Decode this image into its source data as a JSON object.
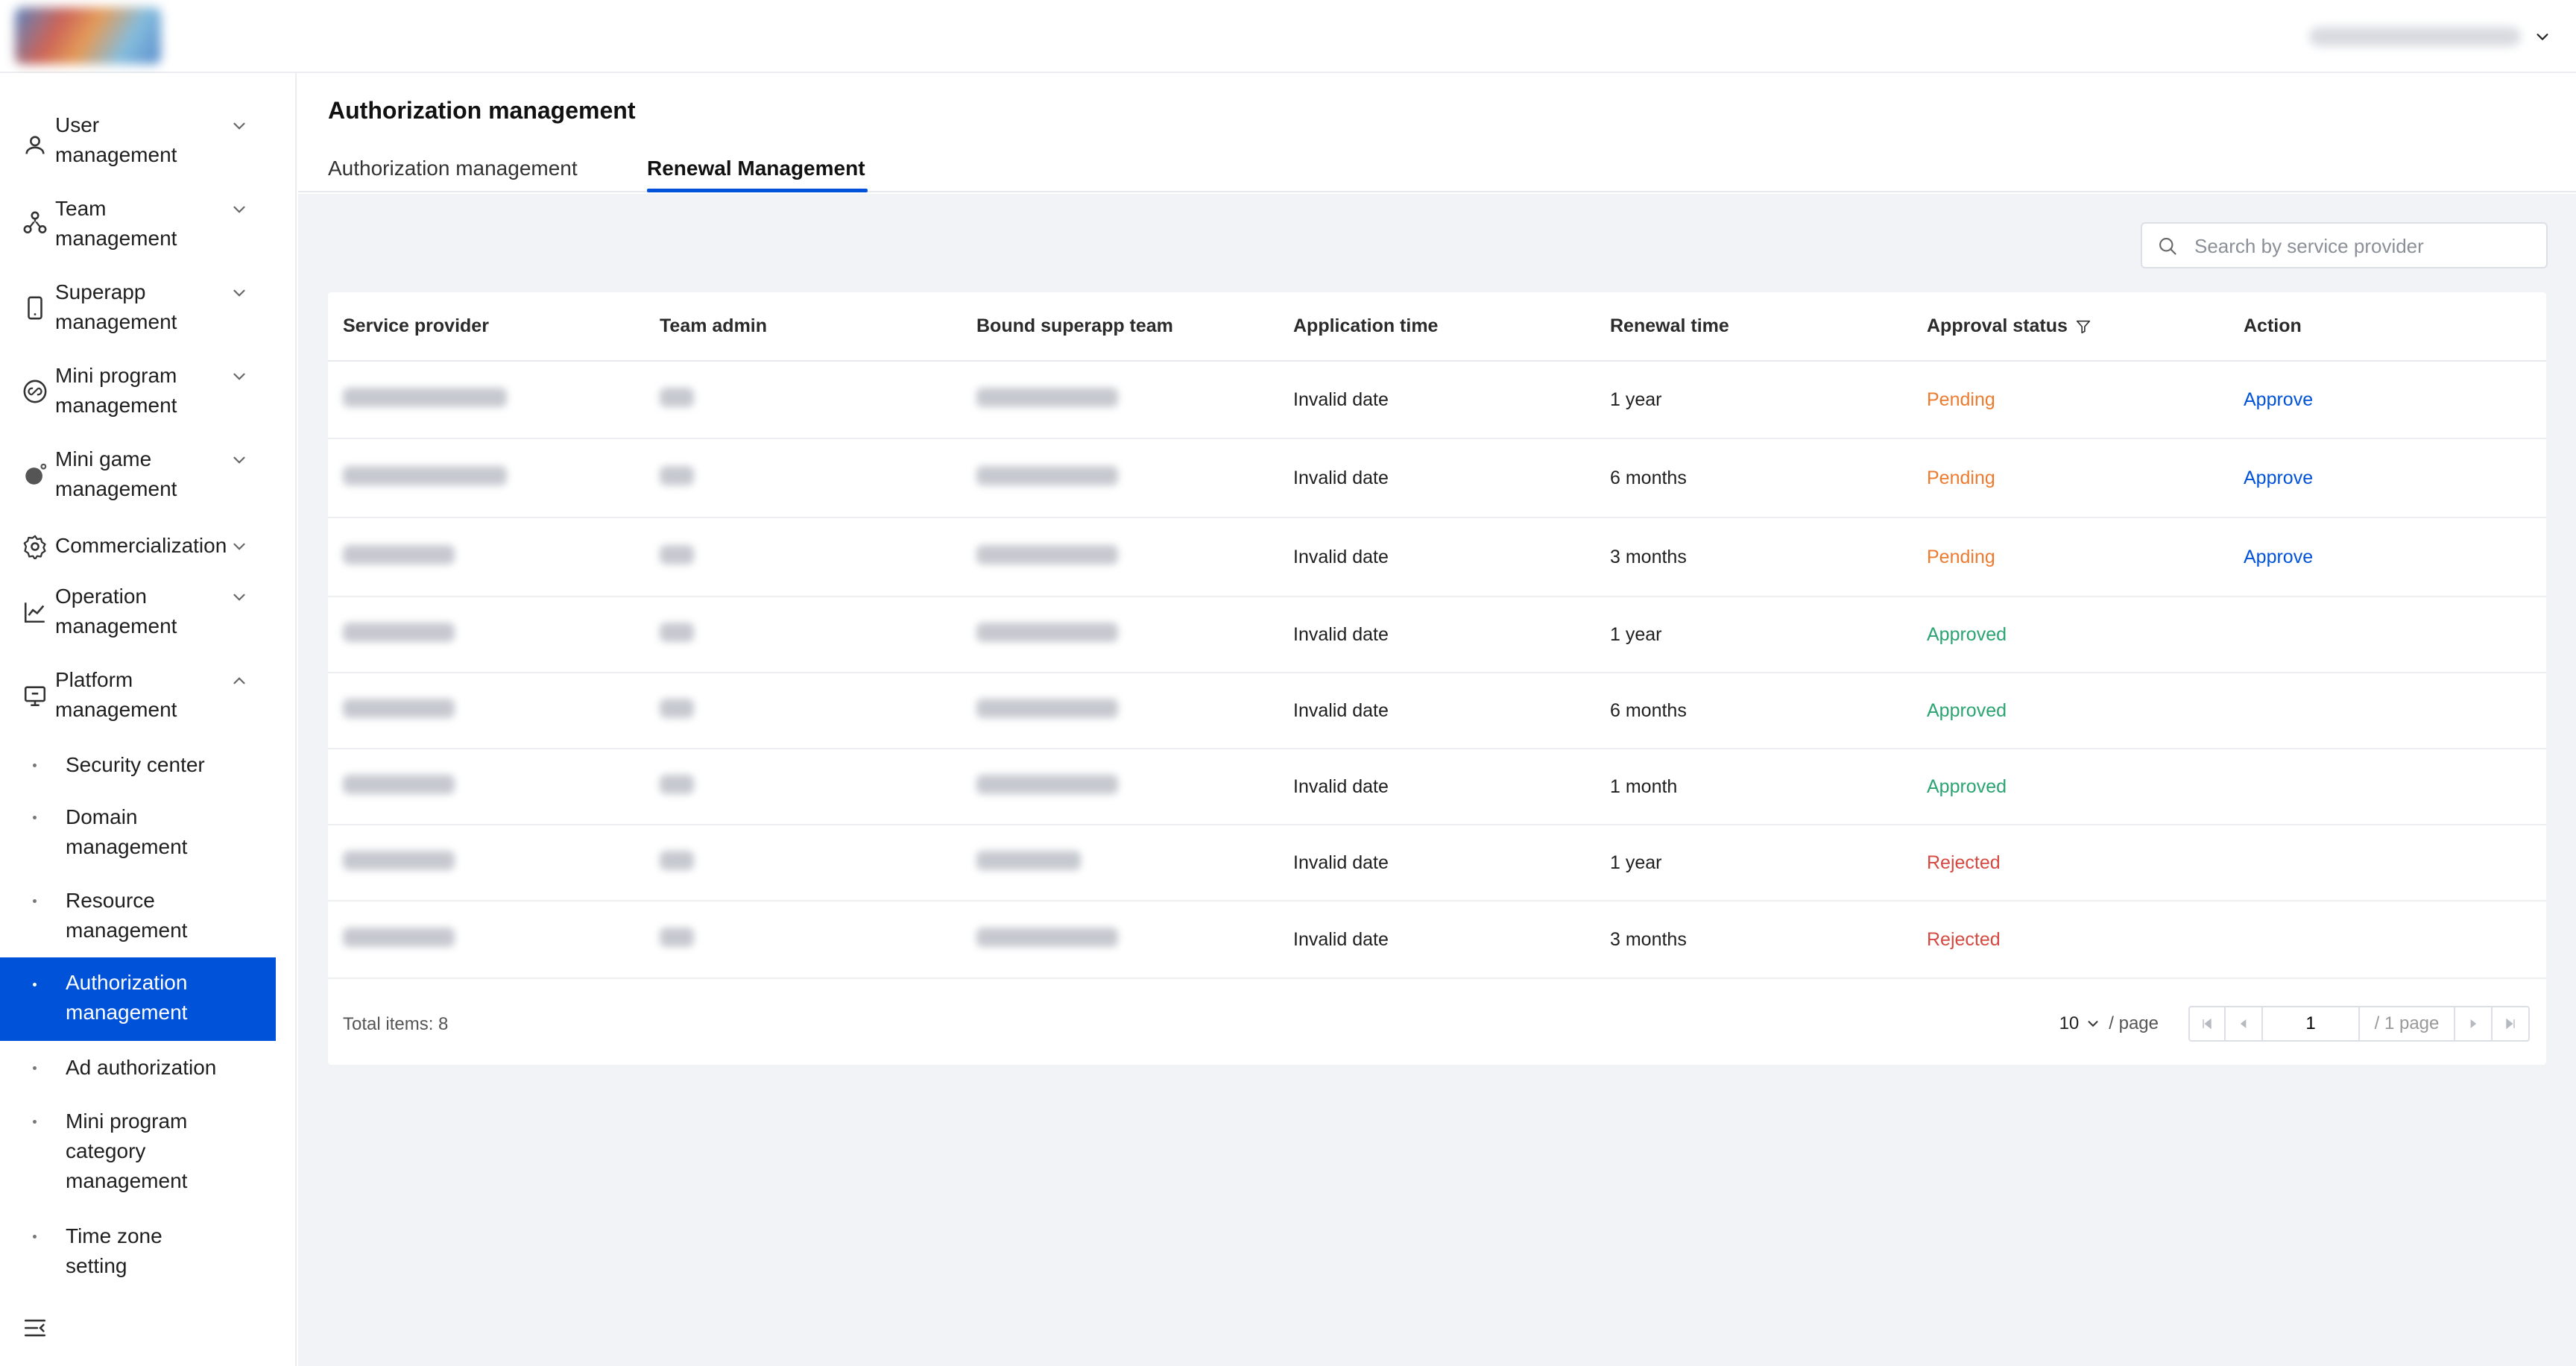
{
  "header": {
    "user_chevron_icon": "chevron-down-icon"
  },
  "sidebar": {
    "groups": [
      {
        "label_line1": "User",
        "label_line2": "management",
        "icon": "user-icon",
        "expanded": false
      },
      {
        "label_line1": "Team",
        "label_line2": "management",
        "icon": "team-icon",
        "expanded": false
      },
      {
        "label_line1": "Superapp",
        "label_line2": "management",
        "icon": "phone-icon",
        "expanded": false
      },
      {
        "label_line1": "Mini program",
        "label_line2": "management",
        "icon": "link-icon",
        "expanded": false
      },
      {
        "label_line1": "Mini game",
        "label_line2": "management",
        "icon": "game-icon",
        "expanded": false
      },
      {
        "label_line1": "Commercialization",
        "label_line2": "",
        "icon": "gear-icon",
        "expanded": false
      },
      {
        "label_line1": "Operation",
        "label_line2": "management",
        "icon": "chart-icon",
        "expanded": false
      },
      {
        "label_line1": "Platform",
        "label_line2": "management",
        "icon": "monitor-icon",
        "expanded": true
      }
    ],
    "sub_items": [
      {
        "line1": "Security center",
        "line2": "",
        "line3": ""
      },
      {
        "line1": "Domain",
        "line2": "management",
        "line3": ""
      },
      {
        "line1": "Resource",
        "line2": "management",
        "line3": ""
      },
      {
        "line1": "Authorization",
        "line2": "management",
        "line3": "",
        "active": true
      },
      {
        "line1": "Ad authorization",
        "line2": "",
        "line3": ""
      },
      {
        "line1": "Mini program",
        "line2": "category",
        "line3": "management"
      },
      {
        "line1": "Time zone",
        "line2": "setting",
        "line3": ""
      }
    ],
    "collapse_icon": "menu-fold-icon"
  },
  "main": {
    "title": "Authorization management",
    "tabs": [
      {
        "label": "Authorization management",
        "active": false
      },
      {
        "label": "Renewal Management",
        "active": true
      }
    ],
    "search": {
      "placeholder": "Search by service provider",
      "value": ""
    },
    "table": {
      "columns": [
        "Service provider",
        "Team admin",
        "Bound superapp team",
        "Application time",
        "Renewal time",
        "Approval status",
        "Action"
      ],
      "rows": [
        {
          "application_time": "Invalid date",
          "renewal_time": "1 year",
          "status": "Pending",
          "action": "Approve"
        },
        {
          "application_time": "Invalid date",
          "renewal_time": "6 months",
          "status": "Pending",
          "action": "Approve"
        },
        {
          "application_time": "Invalid date",
          "renewal_time": "3 months",
          "status": "Pending",
          "action": "Approve"
        },
        {
          "application_time": "Invalid date",
          "renewal_time": "1 year",
          "status": "Approved",
          "action": ""
        },
        {
          "application_time": "Invalid date",
          "renewal_time": "6 months",
          "status": "Approved",
          "action": ""
        },
        {
          "application_time": "Invalid date",
          "renewal_time": "1 month",
          "status": "Approved",
          "action": ""
        },
        {
          "application_time": "Invalid date",
          "renewal_time": "1 year",
          "status": "Rejected",
          "action": ""
        },
        {
          "application_time": "Invalid date",
          "renewal_time": "3 months",
          "status": "Rejected",
          "action": ""
        }
      ]
    },
    "footer": {
      "total": "Total items: 8",
      "page_size": "10",
      "per_page": "/ page",
      "current_page": "1",
      "total_pages": "/ 1 page"
    }
  },
  "colors": {
    "accent": "#0052d9",
    "pending": "#ed7b2f",
    "approved": "#2ba471",
    "rejected": "#d54941"
  }
}
